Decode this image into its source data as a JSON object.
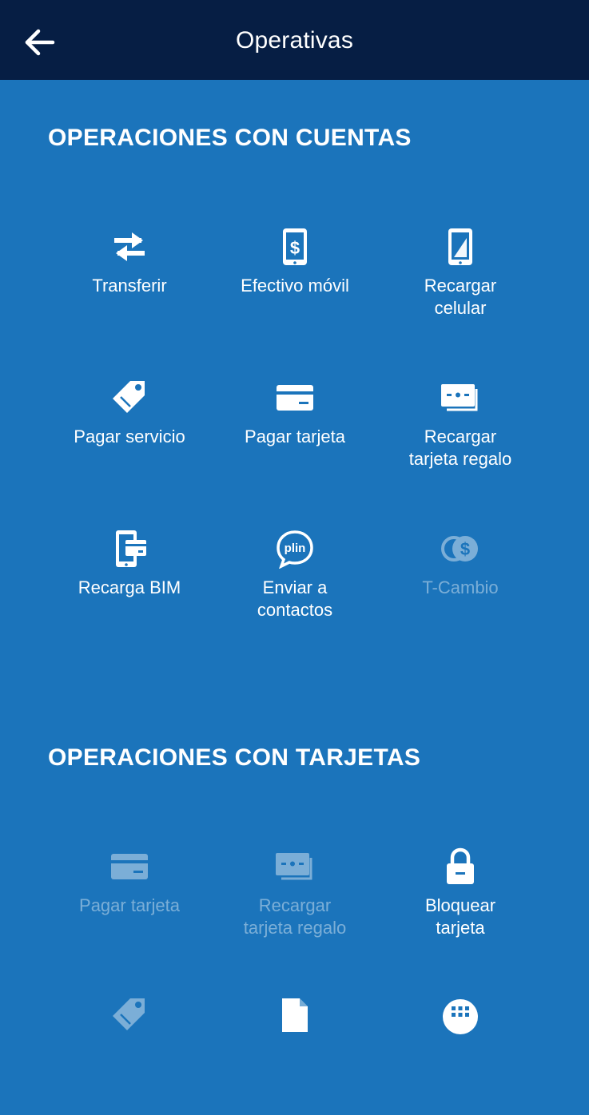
{
  "header": {
    "title": "Operativas"
  },
  "sections": [
    {
      "title": "OPERACIONES CON CUENTAS",
      "items": [
        {
          "label": "Transferir",
          "icon": "transfer-arrows-icon",
          "enabled": true
        },
        {
          "label": "Efectivo móvil",
          "icon": "phone-cash-icon",
          "enabled": true
        },
        {
          "label": "Recargar\ncelular",
          "icon": "phone-recharge-icon",
          "enabled": true
        },
        {
          "label": "Pagar servicio",
          "icon": "tag-icon",
          "enabled": true
        },
        {
          "label": "Pagar tarjeta",
          "icon": "card-icon",
          "enabled": true
        },
        {
          "label": "Recargar\ntarjeta regalo",
          "icon": "gift-cards-icon",
          "enabled": true
        },
        {
          "label": "Recarga BIM",
          "icon": "bim-wallet-icon",
          "enabled": true
        },
        {
          "label": "Enviar a\ncontactos",
          "icon": "plin-icon",
          "enabled": true
        },
        {
          "label": "T-Cambio",
          "icon": "currency-exchange-icon",
          "enabled": false
        }
      ]
    },
    {
      "title": "OPERACIONES CON TARJETAS",
      "items": [
        {
          "label": "Pagar tarjeta",
          "icon": "card-icon",
          "enabled": false
        },
        {
          "label": "Recargar\ntarjeta regalo",
          "icon": "gift-cards-icon",
          "enabled": false
        },
        {
          "label": "Bloquear\ntarjeta",
          "icon": "lock-icon",
          "enabled": true
        },
        {
          "label": "",
          "icon": "tag-icon",
          "enabled": false
        },
        {
          "label": "",
          "icon": "document-icon",
          "enabled": true
        },
        {
          "label": "",
          "icon": "grid-keypad-icon",
          "enabled": true
        }
      ]
    }
  ],
  "plin_text": "plin",
  "colors": {
    "header_bg": "#061e44",
    "page_bg": "#1b74bb",
    "text": "#ffffff"
  }
}
